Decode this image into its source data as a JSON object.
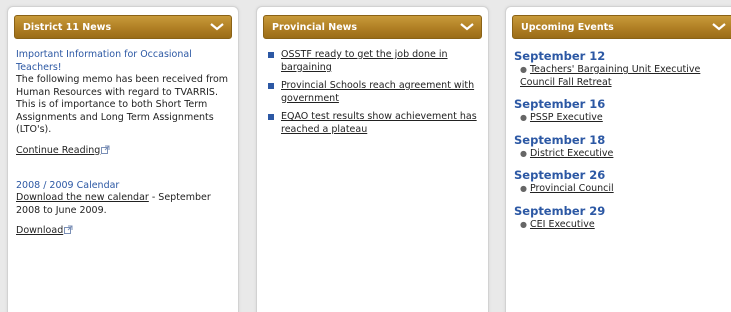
{
  "columns": {
    "district": {
      "title": "District 11 News",
      "article": {
        "title": "Important Information for Occasional Teachers!",
        "body": "The following memo has been received from Human Resources with regard to TVARRIS. This is of importance to both Short Term Assignments and Long Term Assignments (LTO's).",
        "continue_label": "Continue Reading"
      },
      "calendar": {
        "title": "2008 / 2009 Calendar",
        "link_label": "Download the new calendar",
        "suffix": " - September 2008 to June 2009.",
        "download_label": "Download"
      }
    },
    "provincial": {
      "title": "Provincial News",
      "items": [
        "OSSTF ready to get the job done in bargaining",
        "Provincial Schools reach agreement with government",
        "EQAO test results show achievement has reached a plateau"
      ]
    },
    "events": {
      "title": "Upcoming Events",
      "items": [
        {
          "date": "September 12",
          "event": "Teachers' Bargaining Unit Executive Council Fall Retreat"
        },
        {
          "date": "September 16",
          "event": "PSSP Executive"
        },
        {
          "date": "September 18",
          "event": "District Executive"
        },
        {
          "date": "September 26",
          "event": "Provincial Council"
        },
        {
          "date": "September 29",
          "event": "CEI Executive"
        }
      ]
    }
  },
  "icons": {
    "chevron": "chevron-down-icon",
    "external": "external-link-icon",
    "bullet": "square-bullet-icon"
  },
  "colors": {
    "header_gold": "#b07f24",
    "link_blue": "#2c58a4"
  }
}
